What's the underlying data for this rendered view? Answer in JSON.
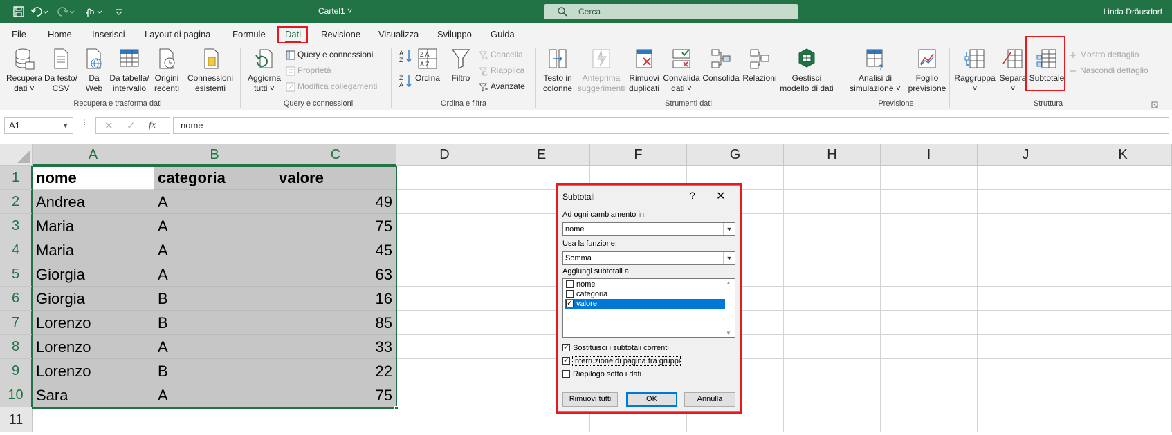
{
  "titlebar": {
    "doc_title": "Cartel1",
    "search_placeholder": "Cerca",
    "user": "Linda Dräusdorf",
    "colors": {
      "bar": "#217346"
    }
  },
  "menu": {
    "tabs": [
      "File",
      "Home",
      "Inserisci",
      "Layout di pagina",
      "Formule",
      "Dati",
      "Revisione",
      "Visualizza",
      "Sviluppo",
      "Guida"
    ],
    "active": "Dati"
  },
  "ribbon": {
    "groups": {
      "recupera": {
        "label": "Recupera e trasforma dati",
        "btn_recupera_dati": [
          "Recupera",
          "dati ˅"
        ],
        "btn_da_testo": [
          "Da testo/",
          "CSV"
        ],
        "btn_da_web": [
          "Da",
          "Web"
        ],
        "btn_da_tabella": [
          "Da tabella/",
          "intervallo"
        ],
        "btn_origini": [
          "Origini",
          "recenti"
        ],
        "btn_connessioni": [
          "Connessioni",
          "esistenti"
        ]
      },
      "query": {
        "label": "Query e connessioni",
        "btn_aggiorna": [
          "Aggiorna",
          "tutti ˅"
        ],
        "query_connessioni": "Query e connessioni",
        "proprieta": "Proprietà",
        "modifica_collegamenti": "Modifica collegamenti"
      },
      "ordina": {
        "label": "Ordina e filtra",
        "ordina": "Ordina",
        "filtro": "Filtro",
        "cancella": "Cancella",
        "riapplica": "Riapplica",
        "avanzate": "Avanzate"
      },
      "strumenti": {
        "label": "Strumenti dati",
        "testo_colonne": [
          "Testo in",
          "colonne"
        ],
        "anteprima": [
          "Anteprima",
          "suggerimenti"
        ],
        "rimuovi_duplicati": [
          "Rimuovi",
          "duplicati"
        ],
        "convalida": [
          "Convalida",
          "dati ˅"
        ],
        "consolida": "Consolida",
        "relazioni": "Relazioni",
        "gestisci": [
          "Gestisci",
          "modello di dati"
        ]
      },
      "previsione": {
        "label": "Previsione",
        "analisi": [
          "Analisi di",
          "simulazione ˅"
        ],
        "foglio": [
          "Foglio",
          "previsione"
        ]
      },
      "struttura": {
        "label": "Struttura",
        "raggruppa": [
          "Raggruppa",
          "˅"
        ],
        "separa": [
          "Separa",
          "˅"
        ],
        "subtotale": "Subtotale",
        "mostra_dettaglio": "Mostra dettaglio",
        "nascondi_dettaglio": "Nascondi dettaglio"
      }
    }
  },
  "formula_bar": {
    "name_box": "A1",
    "fx": "fx",
    "formula": "nome"
  },
  "sheet": {
    "columns": [
      "A",
      "B",
      "C",
      "D",
      "E",
      "F",
      "G",
      "H",
      "I",
      "J",
      "K"
    ],
    "rows": [
      "1",
      "2",
      "3",
      "4",
      "5",
      "6",
      "7",
      "8",
      "9",
      "10",
      "11"
    ],
    "data": [
      [
        "nome",
        "categoria",
        "valore"
      ],
      [
        "Andrea",
        "A",
        "49"
      ],
      [
        "Maria",
        "A",
        "75"
      ],
      [
        "Maria",
        "A",
        "45"
      ],
      [
        "Giorgia",
        "A",
        "63"
      ],
      [
        "Giorgia",
        "B",
        "16"
      ],
      [
        "Lorenzo",
        "B",
        "85"
      ],
      [
        "Lorenzo",
        "A",
        "33"
      ],
      [
        "Lorenzo",
        "B",
        "22"
      ],
      [
        "Sara",
        "A",
        "75"
      ]
    ]
  },
  "dialog": {
    "title": "Subtotali",
    "help": "?",
    "close": "✕",
    "label_group_by": "Ad ogni cambiamento in:",
    "group_by_value": "nome",
    "label_function": "Usa la funzione:",
    "function_value": "Somma",
    "label_add_to": "Aggiungi subtotali a:",
    "add_to_items": [
      {
        "label": "nome",
        "checked": false,
        "selected": false
      },
      {
        "label": "categoria",
        "checked": false,
        "selected": false
      },
      {
        "label": "valore",
        "checked": true,
        "selected": true
      }
    ],
    "options": [
      {
        "label": "Sostituisci i subtotali correnti",
        "checked": true
      },
      {
        "label": "Interruzione di pagina tra gruppi",
        "checked": true
      },
      {
        "label": "Riepilogo sotto i dati",
        "checked": false
      }
    ],
    "btn_remove_all": "Rimuovi tutti",
    "btn_ok": "OK",
    "btn_cancel": "Annulla"
  }
}
